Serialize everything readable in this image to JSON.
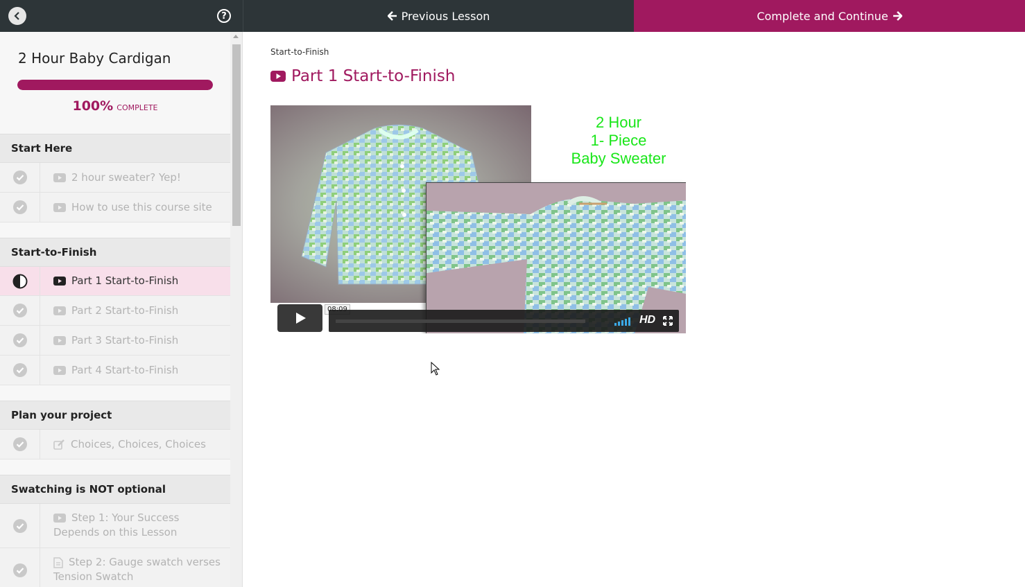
{
  "topbar": {
    "previous_label": "Previous Lesson",
    "complete_label": "Complete and Continue"
  },
  "sidebar": {
    "course_title": "2 Hour Baby Cardigan",
    "progress": {
      "percent_text": "100%",
      "complete_text": "COMPLETE",
      "value": 1.0
    },
    "sections": [
      {
        "title": "Start Here",
        "lessons": [
          {
            "label": "2 hour sweater? Yep!",
            "type": "video",
            "status": "complete"
          },
          {
            "label": "How to use this course site",
            "type": "video",
            "status": "complete"
          }
        ]
      },
      {
        "title": "Start-to-Finish",
        "lessons": [
          {
            "label": "Part 1 Start-to-Finish",
            "type": "video",
            "status": "in-progress"
          },
          {
            "label": "Part 2 Start-to-Finish",
            "type": "video",
            "status": "complete"
          },
          {
            "label": "Part 3 Start-to-Finish",
            "type": "video",
            "status": "complete"
          },
          {
            "label": "Part 4 Start-to-Finish",
            "type": "video",
            "status": "complete"
          }
        ]
      },
      {
        "title": "Plan your project",
        "lessons": [
          {
            "label": "Choices, Choices, Choices",
            "type": "edit",
            "status": "complete"
          }
        ]
      },
      {
        "title": "Swatching is NOT optional",
        "lessons": [
          {
            "label": "Step 1: Your Success Depends on this Lesson",
            "type": "video",
            "status": "complete"
          },
          {
            "label": "Step 2: Gauge swatch verses Tension Swatch",
            "type": "document",
            "status": "complete"
          }
        ]
      }
    ]
  },
  "main": {
    "breadcrumb": "Start-to-Finish",
    "lesson_title": "Part 1 Start-to-Finish",
    "video": {
      "overlay_text": [
        "2 Hour",
        "1- Piece",
        "Baby Sweater"
      ],
      "duration": "08:09",
      "hd_label": "HD"
    }
  },
  "colors": {
    "accent": "#a0195f",
    "topbar": "#2d3538",
    "active_lesson_bg": "#f8dfea",
    "overlay_text": "#19e619"
  },
  "icons": {
    "back": "chevron-left-icon",
    "help": "question-circle-icon",
    "prev": "arrow-left-icon",
    "next": "arrow-right-icon",
    "complete": "check-circle-icon",
    "in_progress": "half-circle-icon",
    "video": "youtube-play-icon",
    "edit": "edit-icon",
    "document": "document-icon"
  }
}
